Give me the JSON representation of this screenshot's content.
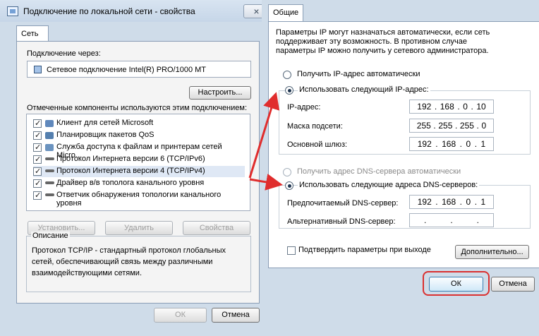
{
  "left": {
    "title": "Подключение по локальной сети - свойства",
    "tab": "Сеть",
    "connect_via_label": "Подключение через:",
    "adapter": "Сетевое подключение Intel(R) PRO/1000 MT",
    "configure_button": "Настроить...",
    "components_label": "Отмеченные компоненты используются этим подключением:",
    "components": [
      {
        "label": "Клиент для сетей Microsoft"
      },
      {
        "label": "Планировщик пакетов QoS"
      },
      {
        "label": "Служба доступа к файлам и принтерам сетей Micro..."
      },
      {
        "label": "Протокол Интернета версии 6 (TCP/IPv6)"
      },
      {
        "label": "Протокол Интернета версии 4 (TCP/IPv4)"
      },
      {
        "label": "Драйвер в/в тополога канального уровня"
      },
      {
        "label": "Ответчик обнаружения топологии канального уровня"
      }
    ],
    "install_button": "Установить...",
    "remove_button": "Удалить",
    "properties_button": "Свойства",
    "description_label": "Описание",
    "description_text": "Протокол TCP/IP - стандартный протокол глобальных сетей, обеспечивающий связь между различными взаимодействующими сетями.",
    "ok_button": "ОК",
    "cancel_button": "Отмена"
  },
  "right": {
    "tab": "Общие",
    "info_text": "Параметры IP могут назначаться автоматически, если сеть поддерживает эту возможность. В противном случае параметры IP можно получить у сетевого администратора.",
    "auto_ip_label": "Получить IP-адрес автоматически",
    "manual_ip_label": "Использовать следующий IP-адрес:",
    "ip_label": "IP-адрес:",
    "mask_label": "Маска подсети:",
    "gateway_label": "Основной шлюз:",
    "ip": [
      "192",
      "168",
      "0",
      "10"
    ],
    "mask": [
      "255",
      "255",
      "255",
      "0"
    ],
    "gateway": [
      "192",
      "168",
      "0",
      "1"
    ],
    "auto_dns_label": "Получить адрес DNS-сервера автоматически",
    "manual_dns_label": "Использовать следующие адреса DNS-серверов:",
    "preferred_dns_label": "Предпочитаемый DNS-сервер:",
    "alternate_dns_label": "Альтернативный DNS-сервер:",
    "preferred_dns": [
      "192",
      "168",
      "0",
      "1"
    ],
    "alternate_dns": [
      "",
      "",
      "",
      ""
    ],
    "validate_label": "Подтвердить параметры при выходе",
    "advanced_button": "Дополнительно...",
    "ok_button": "ОК",
    "cancel_button": "Отмена"
  },
  "colors": {
    "annotation_red": "#e02d2d",
    "window_blue": "#cfdce9"
  }
}
